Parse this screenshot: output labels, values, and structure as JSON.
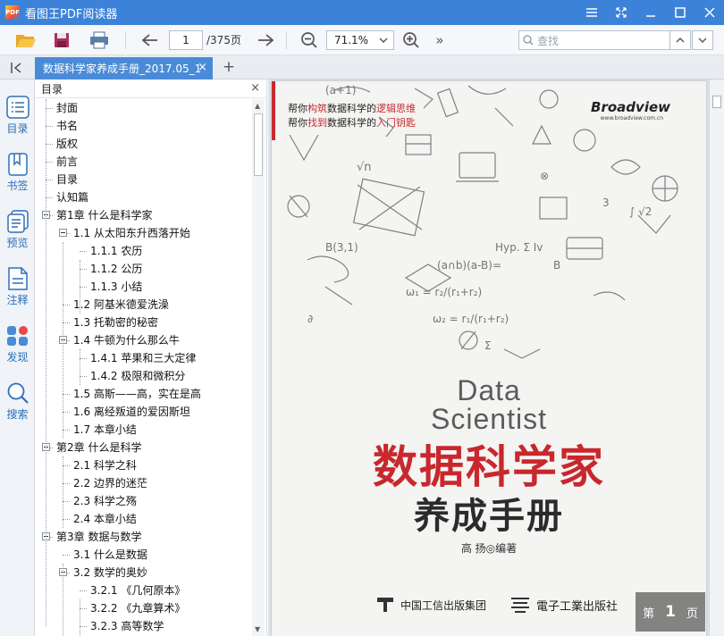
{
  "app": {
    "title": "看图王PDF阅读器",
    "logo_text": "PDF"
  },
  "toolbar": {
    "page_current": "1",
    "page_total": "/375页",
    "zoom": "71.1%",
    "search_placeholder": "查找",
    "more": "»"
  },
  "tab": {
    "label": "数据科学家养成手册_2017.05_1",
    "close": "×",
    "new": "+"
  },
  "sidenav": [
    {
      "label": "目录"
    },
    {
      "label": "书签"
    },
    {
      "label": "预览"
    },
    {
      "label": "注释"
    },
    {
      "label": "发现"
    },
    {
      "label": "搜索"
    }
  ],
  "toc": {
    "header": "目录",
    "items": [
      {
        "text": "封面"
      },
      {
        "text": "书名"
      },
      {
        "text": "版权"
      },
      {
        "text": "前言"
      },
      {
        "text": "目录"
      },
      {
        "text": "认知篇"
      },
      {
        "text": "第1章 什么是科学家"
      },
      {
        "text": "1.1 从太阳东升西落开始"
      },
      {
        "text": "1.1.1 农历"
      },
      {
        "text": "1.1.2 公历"
      },
      {
        "text": "1.1.3 小结"
      },
      {
        "text": "1.2 阿基米德爱洗澡"
      },
      {
        "text": "1.3 托勒密的秘密"
      },
      {
        "text": "1.4 牛顿为什么那么牛"
      },
      {
        "text": "1.4.1 苹果和三大定律"
      },
      {
        "text": "1.4.2 极限和微积分"
      },
      {
        "text": "1.5 高斯——高，实在是高"
      },
      {
        "text": "1.6 离经叛道的爱因斯坦"
      },
      {
        "text": "1.7 本章小结"
      },
      {
        "text": "第2章 什么是科学"
      },
      {
        "text": "2.1 科学之科"
      },
      {
        "text": "2.2 边界的迷茫"
      },
      {
        "text": "2.3 科学之殇"
      },
      {
        "text": "2.4 本章小结"
      },
      {
        "text": "第3章 数据与数学"
      },
      {
        "text": "3.1 什么是数据"
      },
      {
        "text": "3.2 数学的奥妙"
      },
      {
        "text": "3.2.1 《几何原本》"
      },
      {
        "text": "3.2.2 《九章算术》"
      },
      {
        "text": "3.2.3 高等数学"
      }
    ]
  },
  "cover": {
    "tagline1_pre": "帮你",
    "tagline1_hl": "构筑",
    "tagline1_mid": "数据科学的",
    "tagline1_hl2": "逻辑思维",
    "tagline2_pre": "帮你",
    "tagline2_hl": "找到",
    "tagline2_mid": "数据科学的",
    "tagline2_hl2": "入门钥匙",
    "brand": "Broadview",
    "brand_url": "www.broadview.com.cn",
    "en_title_1": "Data",
    "en_title_2": "Scientist",
    "title_cn": "数据科学家",
    "subtitle_cn": "养成手册",
    "author": "高 扬◎编著",
    "publisher1": "中国工信出版集团",
    "publisher2": "電子工業出版社"
  },
  "page_badge": {
    "prefix": "第",
    "num": "1",
    "suffix": "页"
  }
}
